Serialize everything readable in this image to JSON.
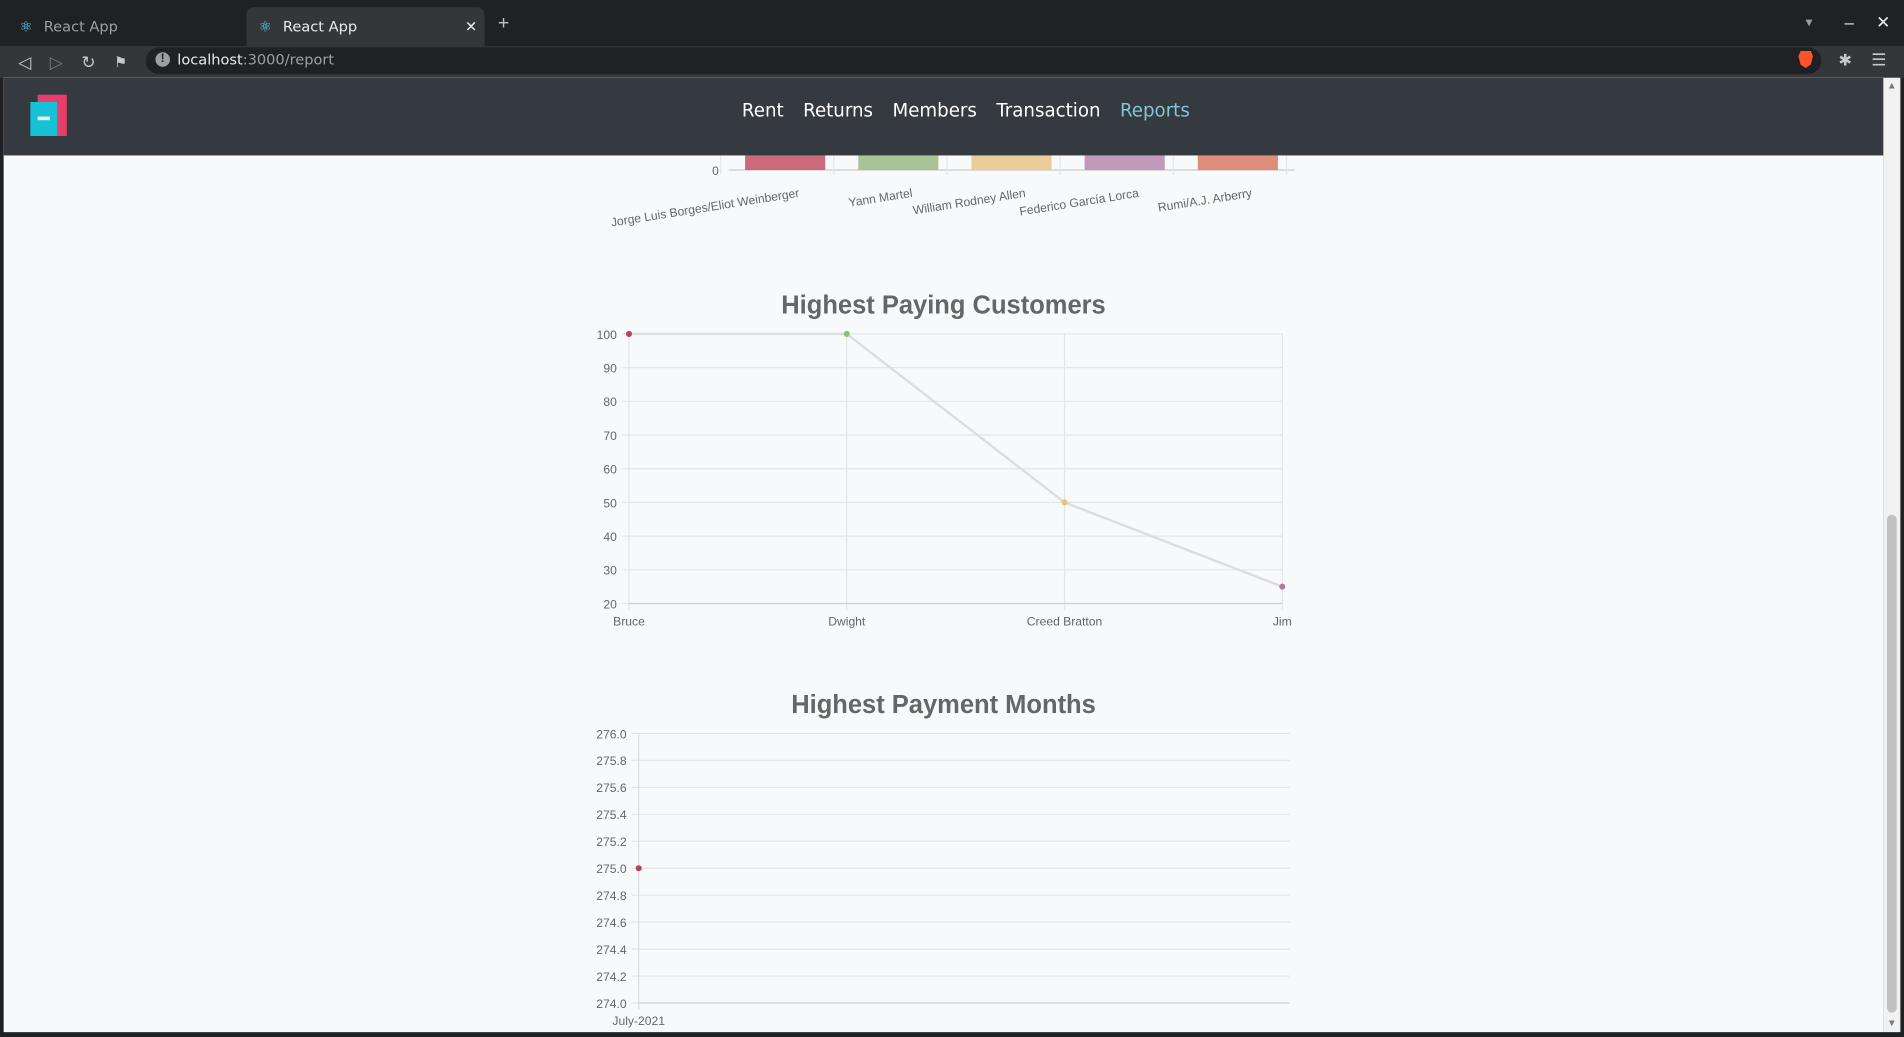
{
  "browser": {
    "tabs": [
      {
        "title": "React App",
        "active": false
      },
      {
        "title": "React App",
        "active": true
      }
    ],
    "url_host": "localhost",
    "url_rest": ":3000/report"
  },
  "navbar": {
    "links": [
      "Rent",
      "Returns",
      "Members",
      "Transaction",
      "Reports"
    ],
    "active": "Reports"
  },
  "chart_data": [
    {
      "type": "bar",
      "title": "",
      "categories": [
        "Jorge Luis Borges/Eliot Weinberger",
        "Yann Martel",
        "William Rodney Allen",
        "Federico García Lorca",
        "Rumi/A.J. Arberry"
      ],
      "colors": [
        "#c45a6b",
        "#9fbd8a",
        "#e9c88e",
        "#b98fb0",
        "#d9826b"
      ],
      "ytick_visible": "0",
      "partial": true
    },
    {
      "type": "line",
      "title": "Highest Paying Customers",
      "categories": [
        "Bruce",
        "Dwight",
        "Creed Bratton",
        "Jim"
      ],
      "values": [
        100,
        100,
        50,
        25
      ],
      "point_colors": [
        "#b5445a",
        "#8fbf7f",
        "#e8c27a",
        "#b07a9a"
      ],
      "line_color": "#dddddd",
      "ylim": [
        20,
        100
      ],
      "yticks": [
        "100",
        "90",
        "80",
        "70",
        "60",
        "50",
        "40",
        "30",
        "20"
      ],
      "grid": true
    },
    {
      "type": "line",
      "title": "Highest Payment Months",
      "categories": [
        "July-2021"
      ],
      "values": [
        275.0
      ],
      "point_colors": [
        "#b5445a"
      ],
      "ylim": [
        274.0,
        276.0
      ],
      "yticks": [
        "276.0",
        "275.8",
        "275.6",
        "275.4",
        "275.2",
        "275.0",
        "274.8",
        "274.6",
        "274.4",
        "274.2",
        "274.0"
      ],
      "grid": true
    }
  ]
}
